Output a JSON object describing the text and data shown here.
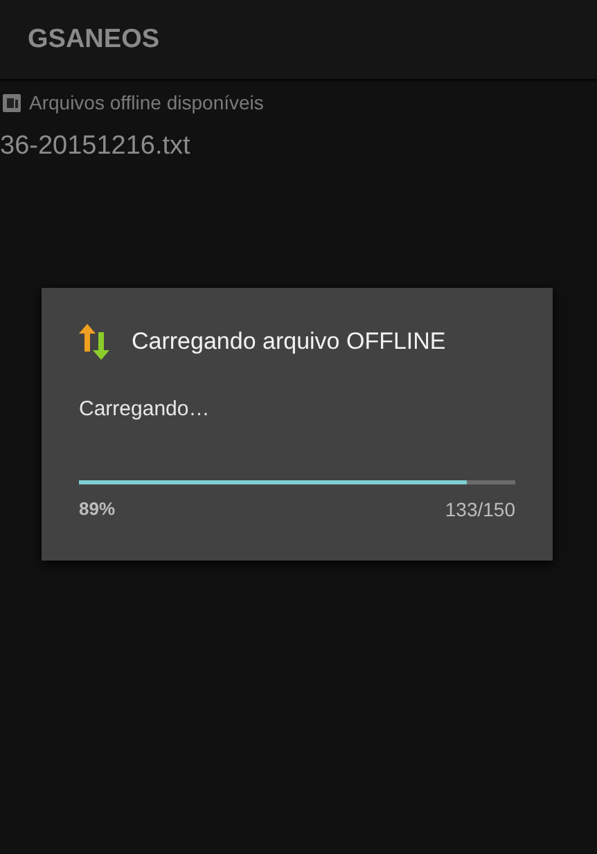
{
  "app_bar": {
    "title": "GSANEOS"
  },
  "section": {
    "label": "Arquivos offline disponíveis"
  },
  "files": [
    "36-20151216.txt"
  ],
  "dialog": {
    "title": "Carregando arquivo OFFLINE",
    "message": "Carregando…",
    "progress": {
      "level": 0.89,
      "percent": "89%",
      "count": "133/150"
    }
  }
}
